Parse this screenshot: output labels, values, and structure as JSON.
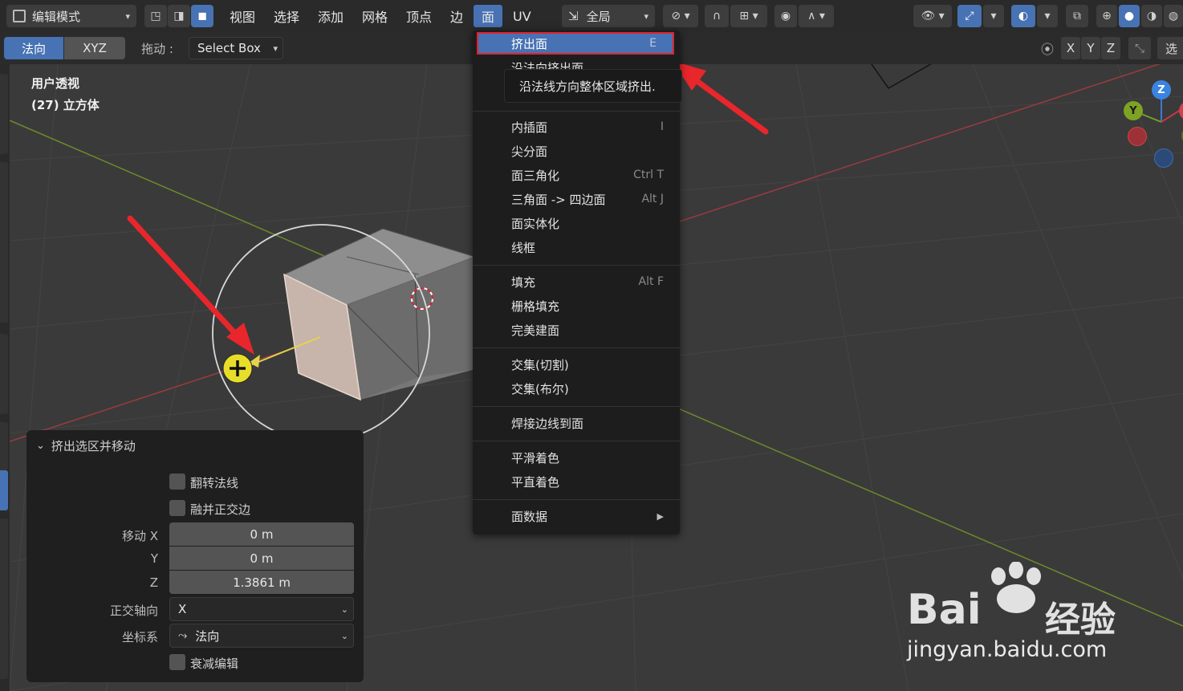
{
  "topbar": {
    "mode": "编辑模式",
    "menus": [
      "视图",
      "选择",
      "添加",
      "网格",
      "顶点",
      "边",
      "面",
      "UV"
    ],
    "transform_orientation": "全局"
  },
  "toolbar2": {
    "orient_normal": "法向",
    "orient_xyz": "XYZ",
    "drag_label": "拖动 :",
    "drag_value": "Select Box",
    "axis_x": "X",
    "axis_y": "Y",
    "axis_z": "Z",
    "options_cut": "选"
  },
  "viewport": {
    "view_name": "用户透视",
    "object_name": "(27) 立方体"
  },
  "gizmo": {
    "z": "Z",
    "y": "Y"
  },
  "face_menu": {
    "items": [
      {
        "label": "挤出面",
        "shortcut": "E"
      },
      {
        "label": "沿法向挤出面",
        "shortcut": ""
      },
      {
        "label": "内插面",
        "shortcut": "I"
      },
      {
        "label": "尖分面",
        "shortcut": ""
      },
      {
        "label": "面三角化",
        "shortcut": "Ctrl T"
      },
      {
        "label": "三角面 -> 四边面",
        "shortcut": "Alt J"
      },
      {
        "label": "面实体化",
        "shortcut": ""
      },
      {
        "label": "线框",
        "shortcut": ""
      },
      {
        "label": "填充",
        "shortcut": "Alt F"
      },
      {
        "label": "栅格填充",
        "shortcut": ""
      },
      {
        "label": "完美建面",
        "shortcut": ""
      },
      {
        "label": "交集(切割)",
        "shortcut": ""
      },
      {
        "label": "交集(布尔)",
        "shortcut": ""
      },
      {
        "label": "焊接边线到面",
        "shortcut": ""
      },
      {
        "label": "平滑着色",
        "shortcut": ""
      },
      {
        "label": "平直着色",
        "shortcut": ""
      },
      {
        "label": "面数据",
        "shortcut": ""
      }
    ],
    "tooltip": "沿法线方向整体区域挤出."
  },
  "operator_panel": {
    "title": "挤出选区并移动",
    "flip_normals": "翻转法线",
    "dissolve_ortho": "融并正交边",
    "move_x_label": "移动 X",
    "move_y_label": "Y",
    "move_z_label": "Z",
    "move_x": "0 m",
    "move_y": "0 m",
    "move_z": "1.3861 m",
    "ortho_axis_label": "正交轴向",
    "ortho_axis_value": "X",
    "coord_label": "坐标系",
    "coord_value": "法向",
    "proportional": "衰减编辑"
  },
  "watermark": {
    "brand": "Bai",
    "brand2": "经验",
    "url": "jingyan.baidu.com"
  },
  "colors": {
    "accent": "#4772b3",
    "highlight_border": "#e0242a",
    "arrow": "#e8262b"
  }
}
